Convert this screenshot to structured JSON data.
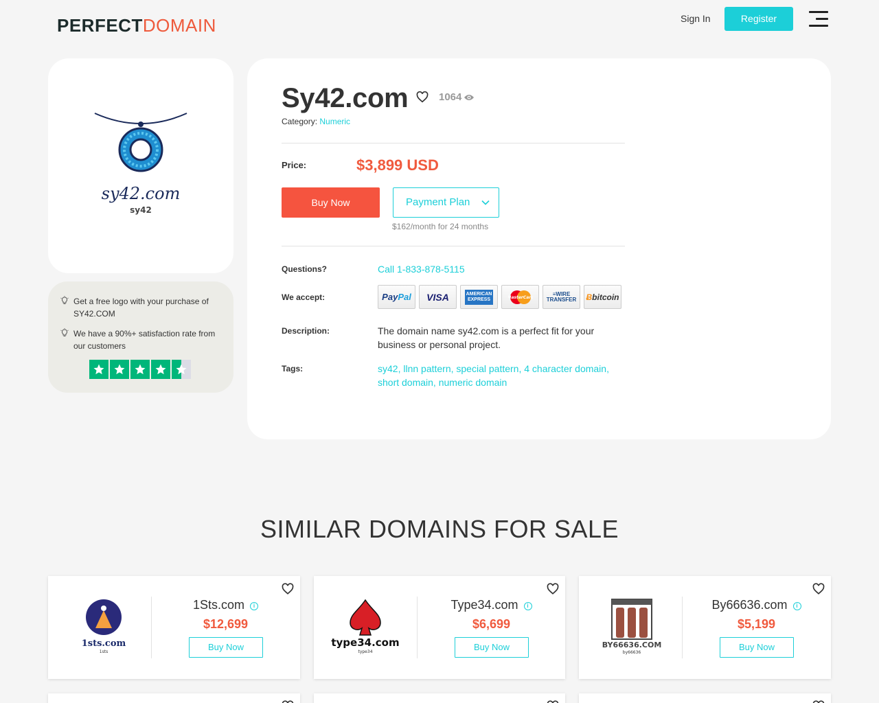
{
  "header": {
    "logo_part1": "PERFECT",
    "logo_part2": "DOMAIN",
    "signin_label": "Sign In",
    "register_label": "Register"
  },
  "logo_card": {
    "logo_text": "sy42.com",
    "logo_subtext": "sy42"
  },
  "info_card": {
    "items": [
      "Get a free logo with your purchase of SY42.COM",
      "We have a 90%+ satisfaction rate from our customers"
    ],
    "rating_stars": 4.5
  },
  "domain": {
    "name": "Sy42.com",
    "views": "1064",
    "category_label": "Category:",
    "category_value": "Numeric",
    "price_label": "Price:",
    "price_value": "$3,899 USD",
    "buy_now_label": "Buy Now",
    "payment_plan_label": "Payment Plan",
    "plan_note": "$162/month for 24 months",
    "questions_label": "Questions?",
    "phone": "Call 1-833-878-5115",
    "accept_label": "We accept:",
    "payment_methods": [
      "PayPal",
      "VISA",
      "AMERICAN EXPRESS",
      "MasterCard",
      "WIRE TRANSFER",
      "bitcoin"
    ],
    "description_label": "Description:",
    "description": "The domain name sy42.com is a perfect fit for your business or personal project.",
    "tags_label": "Tags:",
    "tags": "sy42, llnn pattern, special pattern, 4 character domain, short domain, numeric domain"
  },
  "similar": {
    "title": "SIMILAR DOMAINS FOR SALE",
    "cards": [
      {
        "name": "1Sts.com",
        "price": "$12,699",
        "buy_label": "Buy Now",
        "logo_text": "1sts.com",
        "logo_sub": "1sts"
      },
      {
        "name": "Type34.com",
        "price": "$6,699",
        "buy_label": "Buy Now",
        "logo_text": "type34.com",
        "logo_sub": "type34"
      },
      {
        "name": "By66636.com",
        "price": "$5,199",
        "buy_label": "Buy Now",
        "logo_text": "BY66636.COM",
        "logo_sub": "by66636"
      }
    ]
  },
  "colors": {
    "accent": "#1ccfd8",
    "price": "#f05a3e",
    "buy_button": "#f5543f",
    "trustpilot": "#00b67a"
  }
}
